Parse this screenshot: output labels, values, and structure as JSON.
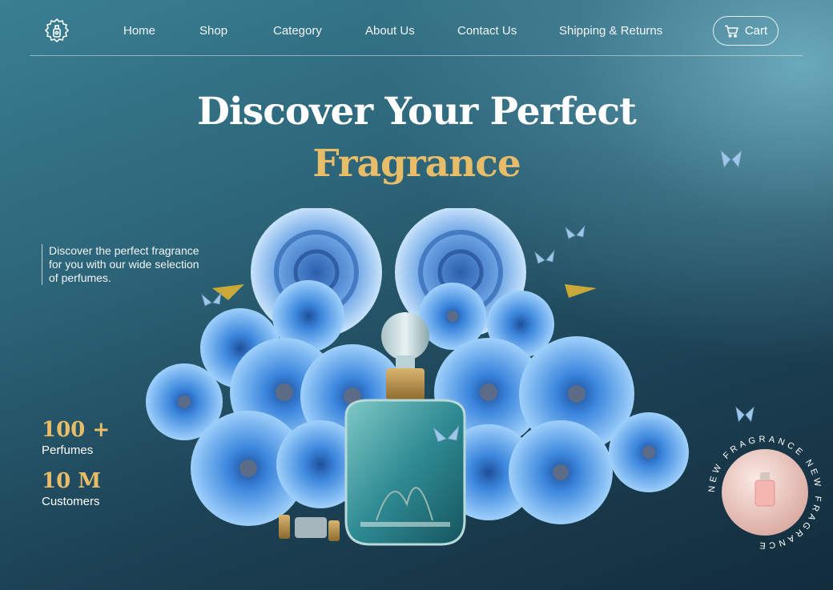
{
  "nav": {
    "links": [
      "Home",
      "Shop",
      "Category",
      "About Us",
      "Contact Us",
      "Shipping & Returns"
    ],
    "cart_label": "Cart"
  },
  "hero": {
    "title_line1": "Discover Your Perfect",
    "title_line2": "Fragrance",
    "tagline": "Discover the perfect fragrance for you with our wide selection of perfumes."
  },
  "stats": [
    {
      "value": "100 +",
      "label": "Perfumes"
    },
    {
      "value": "10 M",
      "label": "Customers"
    }
  ],
  "badge": {
    "text": "NEW FRAGRANCE NEW FRAGRANCE"
  },
  "colors": {
    "accent_gold": "#e7bd6a",
    "flower_blue": "#3f8fe0",
    "bottle_teal": "#3f9aa0"
  },
  "icons": {
    "logo": "perfume-bottle-gear-icon",
    "cart": "cart-icon",
    "butterfly": "butterfly-icon"
  }
}
